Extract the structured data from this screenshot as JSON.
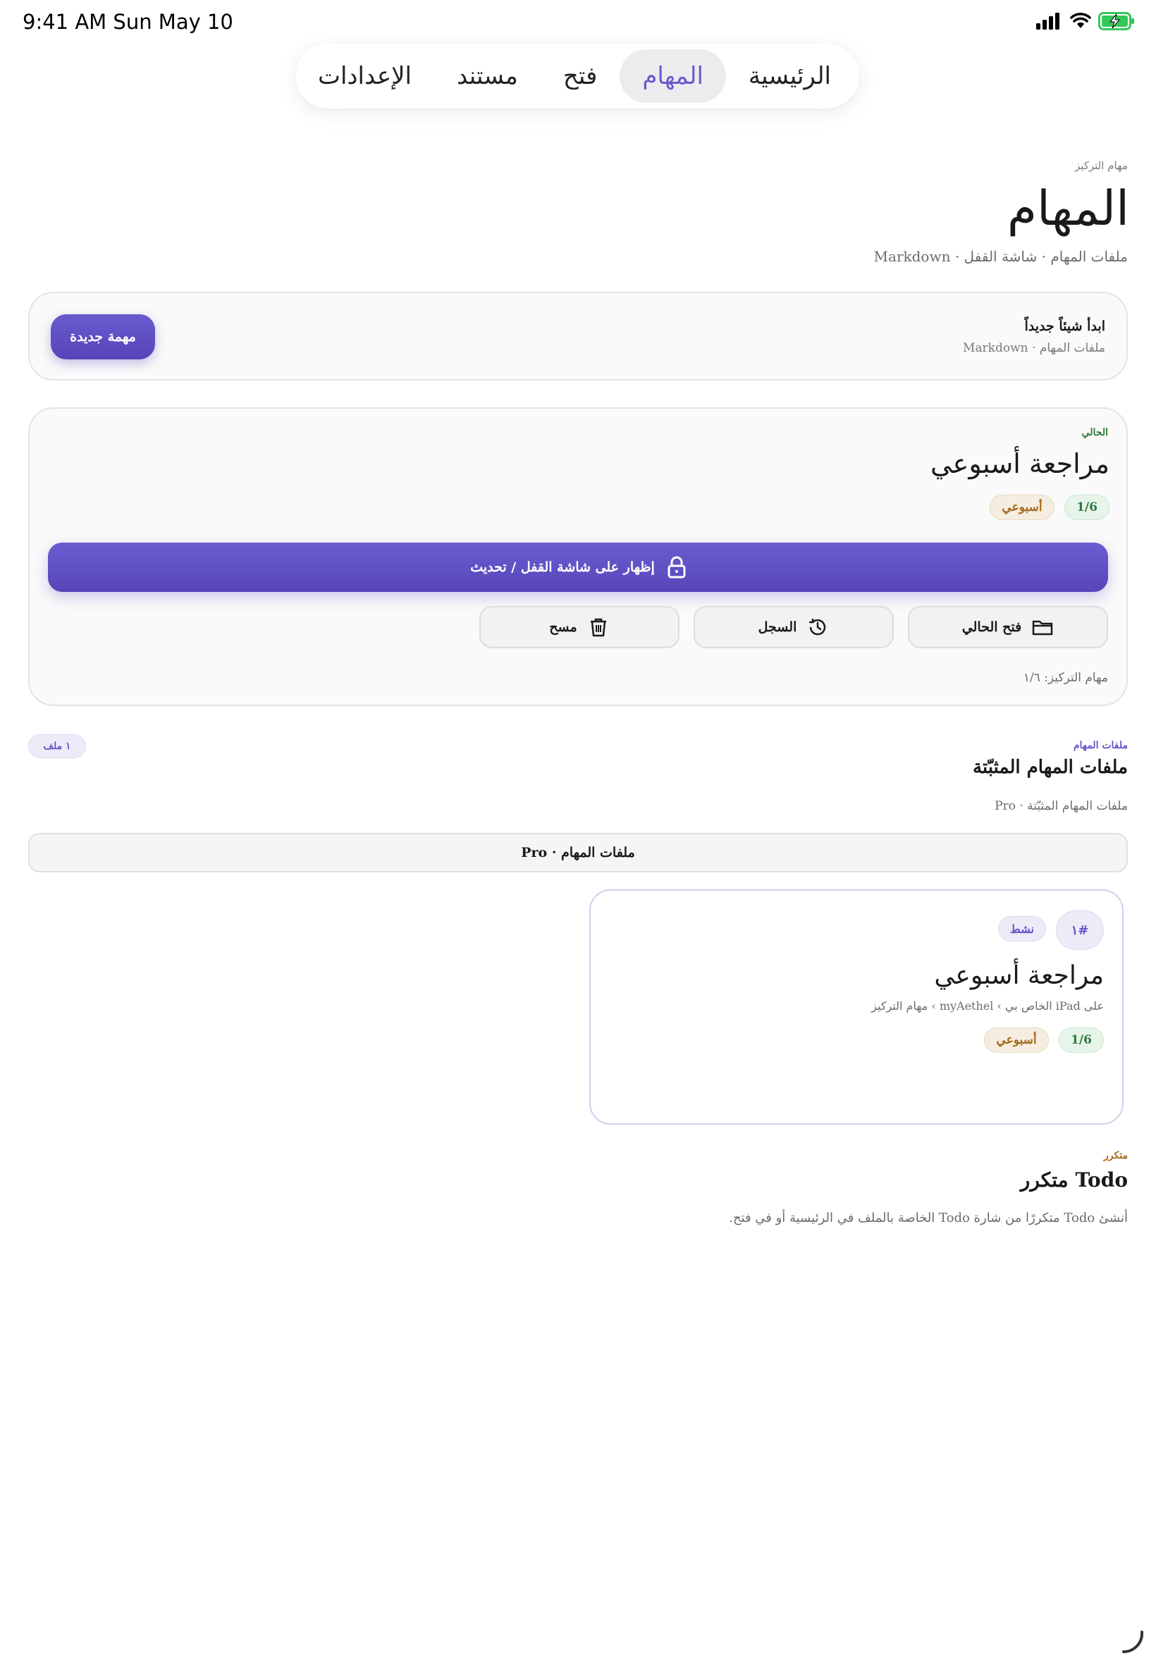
{
  "status_bar": {
    "time": "9:41 AM   Sun May 10"
  },
  "tabs": [
    {
      "label": "الرئيسية"
    },
    {
      "label": "المهام",
      "active": true
    },
    {
      "label": "فتح"
    },
    {
      "label": "مستند"
    },
    {
      "label": "الإعدادات"
    }
  ],
  "header": {
    "eyebrow": "مهام التركيز",
    "title": "المهام",
    "subtitle": "ملفات المهام · شاشة القفل · Markdown"
  },
  "new_card": {
    "title": "ابدأ شيئاً جديداً",
    "subtitle": "ملفات المهام · Markdown",
    "button": "مهمة جديدة"
  },
  "current": {
    "eyebrow": "الحالي",
    "title": "مراجعة أسبوعي",
    "count_pill": "1/6",
    "cadence_pill": "أسبوعي",
    "lock_button": "إظهار على شاشة القفل / تحديث",
    "open_button": "فتح الحالي",
    "history_button": "السجل",
    "clear_button": "مسح",
    "footer": "مهام التركيز: ١/٦"
  },
  "pinned": {
    "eyebrow": "ملفات المهام",
    "title": "ملفات المهام المثبّتة",
    "subtitle": "ملفات المهام المثبّتة · Pro",
    "count_badge": "١ ملف",
    "pro_bar": "ملفات المهام · Pro"
  },
  "task_card": {
    "index": "#١",
    "status": "نشط",
    "title": "مراجعة أسبوعي",
    "path": "على iPad الخاص بي › myAethel › مهام التركيز",
    "count_pill": "1/6",
    "cadence_pill": "أسبوعي"
  },
  "recurring": {
    "eyebrow": "متكرر",
    "title": "Todo متكرر",
    "description": "أنشئ Todo متكررًا من شارة Todo الخاصة بالملف في الرئيسية أو في فتح."
  },
  "colors": {
    "accent": "#6654c4",
    "green": "#2f7a3f",
    "orange": "#a46a1e"
  }
}
